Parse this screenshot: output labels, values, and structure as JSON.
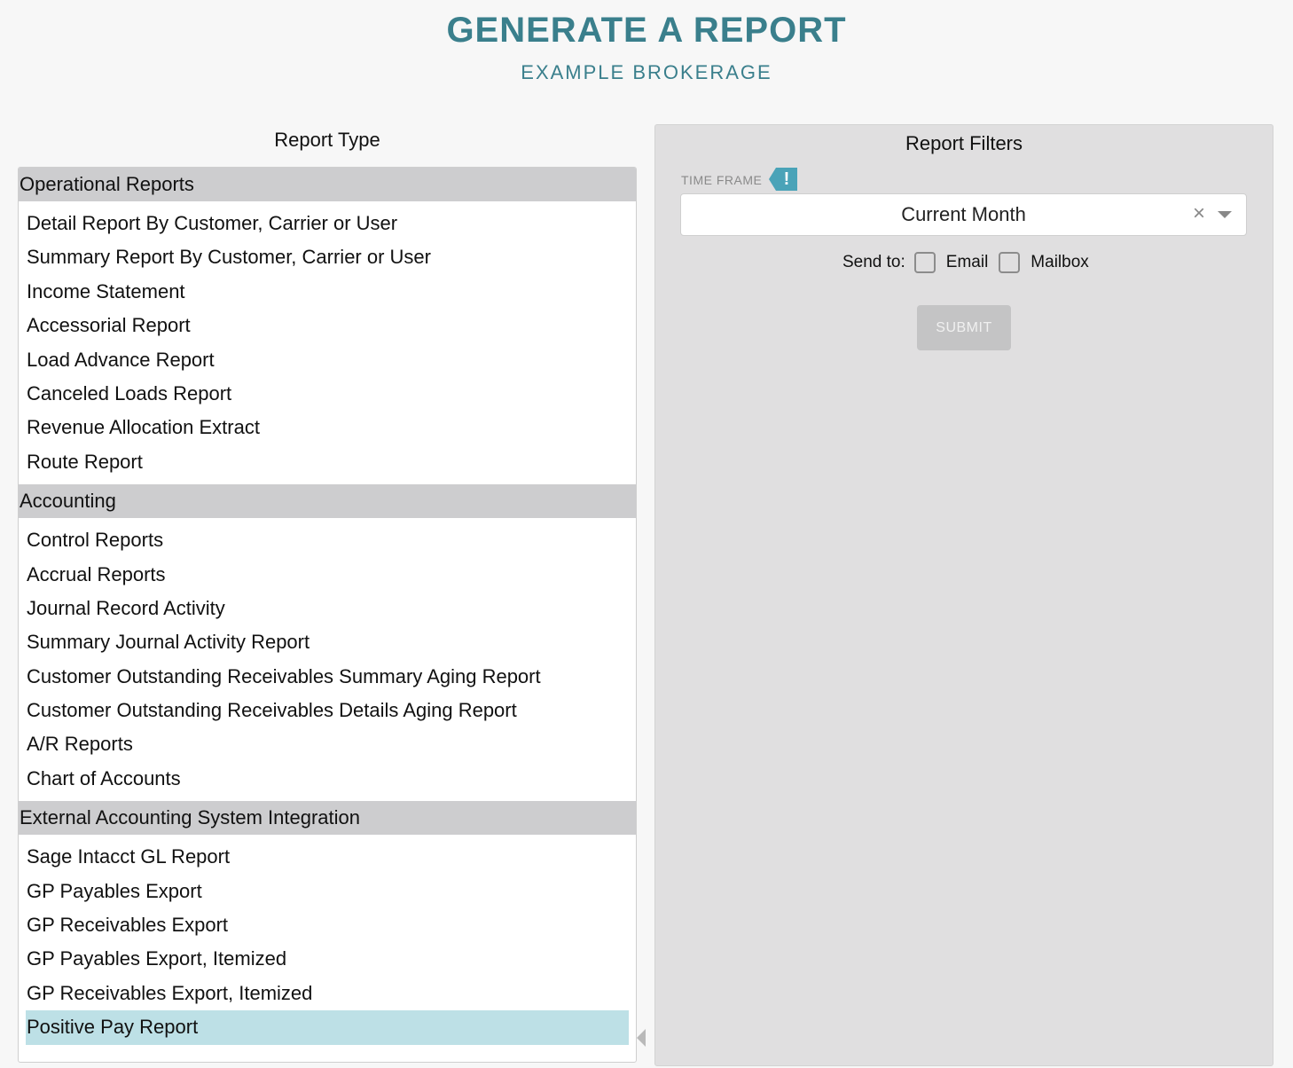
{
  "header": {
    "title": "GENERATE A REPORT",
    "subtitle": "EXAMPLE BROKERAGE"
  },
  "report_type": {
    "heading": "Report Type",
    "groups": [
      {
        "label": "Operational Reports",
        "items": [
          "Detail Report By Customer, Carrier or User",
          "Summary Report By Customer, Carrier or User",
          "Income Statement",
          "Accessorial Report",
          "Load Advance Report",
          "Canceled Loads Report",
          "Revenue Allocation Extract",
          "Route Report"
        ]
      },
      {
        "label": "Accounting",
        "items": [
          "Control Reports",
          "Accrual Reports",
          "Journal Record Activity",
          "Summary Journal Activity Report",
          "Customer Outstanding Receivables Summary Aging Report",
          "Customer Outstanding Receivables Details Aging Report",
          "A/R Reports",
          "Chart of Accounts"
        ]
      },
      {
        "label": "External Accounting System Integration",
        "items": [
          "Sage Intacct GL Report",
          "GP Payables Export",
          "GP Receivables Export",
          "GP Payables Export, Itemized",
          "GP Receivables Export, Itemized",
          "Positive Pay Report"
        ]
      }
    ],
    "selected": "Positive Pay Report"
  },
  "filters": {
    "heading": "Report Filters",
    "time_frame_label": "TIME FRAME",
    "alert_icon": "exclamation-tag-icon",
    "alert_mark": "!",
    "time_frame_value": "Current Month",
    "clear_glyph": "×",
    "send_to_label": "Send to:",
    "email_label": "Email",
    "email_checked": false,
    "mailbox_label": "Mailbox",
    "mailbox_checked": false,
    "submit_label": "SUBMIT"
  },
  "colors": {
    "accent": "#3a7f8c",
    "selected_row": "#bde0e6",
    "group_header": "#cdcdcf",
    "alert": "#4aa3b8",
    "panel": "#e0dfe0",
    "submit_disabled": "#c4c4c5"
  }
}
